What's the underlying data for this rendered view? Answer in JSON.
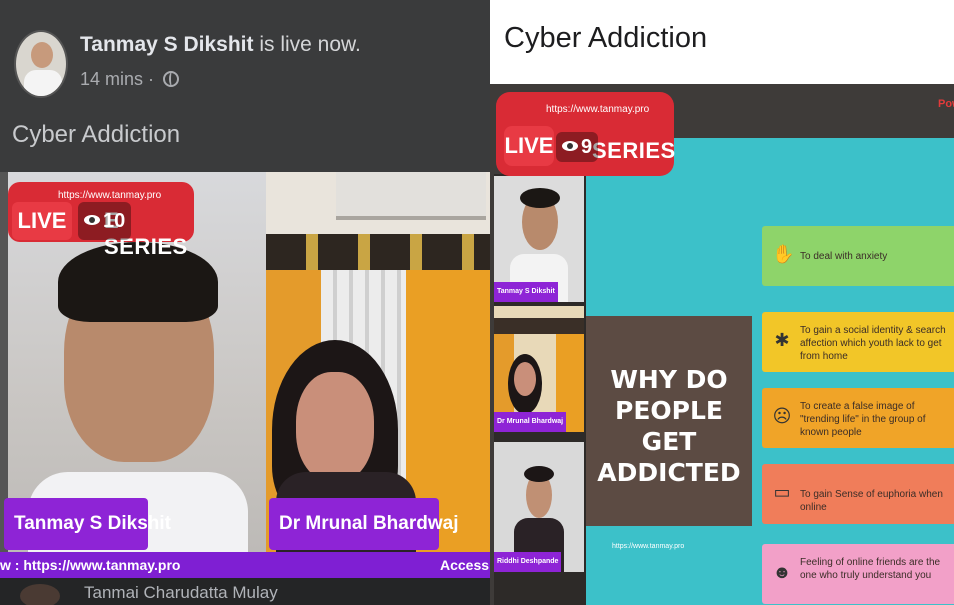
{
  "left": {
    "post": {
      "name": "Tanmay S Dikshit",
      "status": " is live now.",
      "time": "14 mins",
      "separator": "·",
      "title": "Cyber Addiction"
    },
    "banner": {
      "live": "LIVE",
      "viewers": "10",
      "series": "E SERIES",
      "url": "https://www.tanmay.pro"
    },
    "participants": [
      {
        "name": "Tanmay S Dikshit"
      },
      {
        "name": "Dr Mrunal Bhardwaj"
      }
    ],
    "ticker": {
      "left": "w : https://www.tanmay.pro",
      "right": "Access P"
    },
    "commenter": {
      "name": "Tanmai Charudatta Mulay"
    }
  },
  "right": {
    "title": "Cyber Addiction",
    "banner": {
      "live": "LIVE",
      "viewers": "9",
      "series": "SERIES",
      "url": "https://www.tanmay.pro",
      "power": "Pow"
    },
    "thumbnails": [
      {
        "name": "Tanmay S Dikshit"
      },
      {
        "name": "Dr Mrunal Bhardwaj"
      },
      {
        "name": "Riddhi Deshpande"
      }
    ],
    "slide": {
      "heading": "WHY DO PEOPLE GET ADDICTED",
      "url": "https://www.tanmay.pro",
      "reasons": [
        {
          "icon": "hands-icon",
          "text": "To deal with anxiety"
        },
        {
          "icon": "network-icon",
          "text": "To gain a social identity & search affection which youth lack to get from home"
        },
        {
          "icon": "frown-icon",
          "text": "To create a false image of \"trending life\" in the group of known people"
        },
        {
          "icon": "laptop-icon",
          "text": "To gain Sense of euphoria when online"
        },
        {
          "icon": "smiley-icon",
          "text": "Feeling of online friends are the one who truly understand you"
        }
      ]
    }
  }
}
